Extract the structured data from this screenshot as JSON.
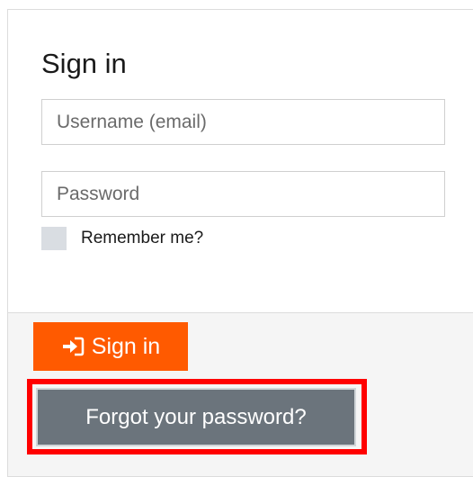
{
  "form": {
    "title": "Sign in",
    "username_placeholder": "Username (email)",
    "username_value": "",
    "password_placeholder": "Password",
    "password_value": "",
    "remember_label": "Remember me?",
    "remember_checked": false
  },
  "actions": {
    "signin_label": "Sign in",
    "signin_icon": "sign-in-icon",
    "forgot_label": "Forgot your password?"
  },
  "colors": {
    "primary": "#ff5a00",
    "secondary_button": "#6b747c",
    "highlight": "#ff0000"
  }
}
